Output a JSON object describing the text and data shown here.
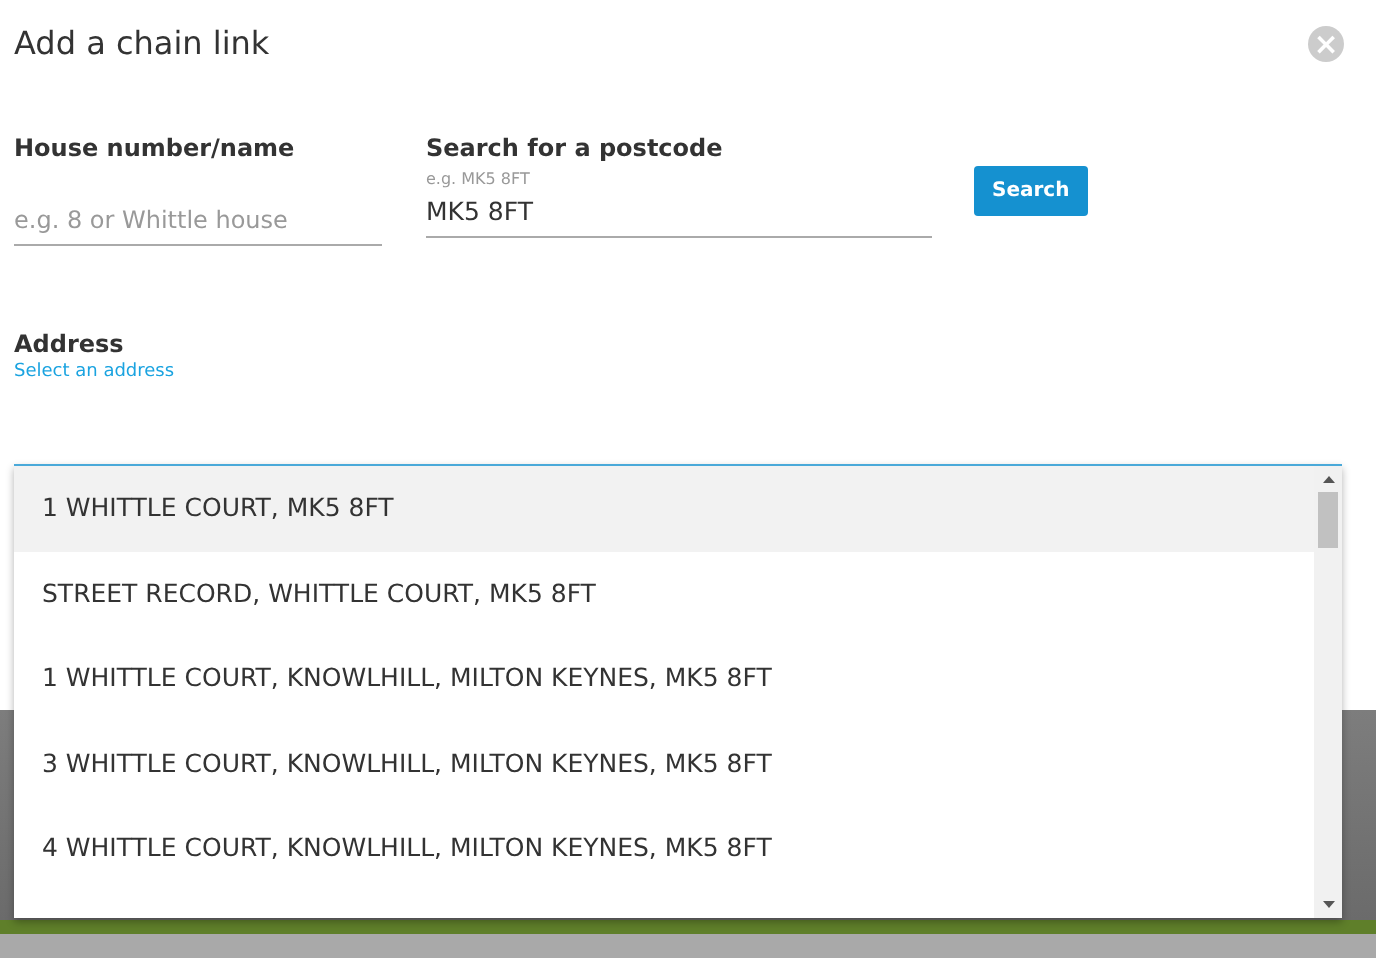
{
  "dialog": {
    "title": "Add a chain link",
    "close_icon": "×"
  },
  "house_field": {
    "label": "House number/name",
    "placeholder": "e.g. 8 or Whittle house"
  },
  "postcode_field": {
    "label": "Search for a postcode",
    "hint": "e.g. MK5 8FT",
    "value": "MK5 8FT"
  },
  "search_button": "Search",
  "address": {
    "label": "Address",
    "hint": "Select an address"
  },
  "options": [
    {
      "text": "1 WHITTLE COURT, MK5 8FT",
      "selected": true
    },
    {
      "text": "STREET RECORD, WHITTLE COURT, MK5 8FT",
      "selected": false
    },
    {
      "text": "1 WHITTLE COURT, KNOWLHILL, MILTON KEYNES, MK5 8FT",
      "selected": false
    },
    {
      "text": "3 WHITTLE COURT, KNOWLHILL, MILTON KEYNES, MK5 8FT",
      "selected": false
    },
    {
      "text": "4 WHITTLE COURT, KNOWLHILL, MILTON KEYNES, MK5 8FT",
      "selected": false
    }
  ]
}
